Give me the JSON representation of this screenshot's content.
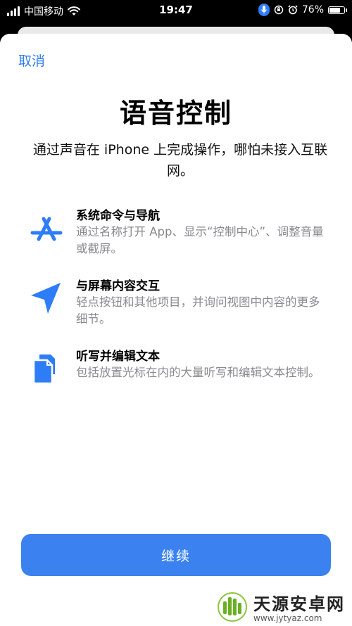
{
  "status_bar": {
    "carrier": "中国移动",
    "time": "19:47",
    "battery": "76%",
    "battery_level": 0.76,
    "icons": [
      "signal-icon",
      "wifi-icon",
      "microphone-icon",
      "orientation-lock-icon",
      "alarm-icon",
      "battery-icon"
    ]
  },
  "nav": {
    "cancel_label": "取消"
  },
  "header": {
    "title": "语音控制",
    "subtitle": "通过声音在 iPhone 上完成操作，哪怕未接入互联网。"
  },
  "features": [
    {
      "icon": "app-store-icon",
      "title": "系统命令与导航",
      "description": "通过名称打开 App、显示“控制中心”、调整音量或截屏。"
    },
    {
      "icon": "location-arrow-icon",
      "title": "与屏幕内容交互",
      "description": "轻点按钮和其他项目，并询问视图中内容的更多细节。"
    },
    {
      "icon": "copy-document-icon",
      "title": "听写并编辑文本",
      "description": "包括放置光标在内的大量听写和编辑文本控制。"
    }
  ],
  "actions": {
    "continue_label": "继续"
  },
  "colors": {
    "accent": "#2f7df6",
    "button": "#3b82f0",
    "secondary_text": "#8a8a8e"
  },
  "watermark": {
    "name": "天源安卓网",
    "url": "www.jytyaz.com"
  }
}
